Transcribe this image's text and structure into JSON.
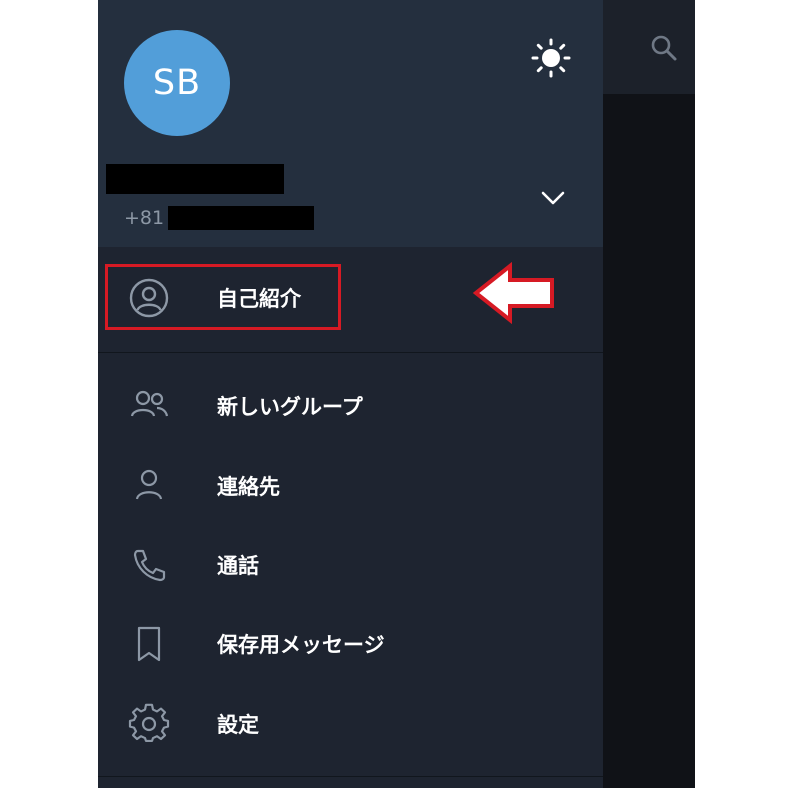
{
  "header": {
    "avatar_initials": "SB",
    "phone_prefix": "+81",
    "avatar_color": "#529ed9",
    "background": "#242f3e"
  },
  "menu": {
    "items": [
      {
        "label": "自己紹介",
        "icon": "profile-circle-icon"
      },
      {
        "label": "新しいグループ",
        "icon": "group-icon"
      },
      {
        "label": "連絡先",
        "icon": "contact-icon"
      },
      {
        "label": "通話",
        "icon": "phone-icon"
      },
      {
        "label": "保存用メッセージ",
        "icon": "bookmark-icon"
      },
      {
        "label": "設定",
        "icon": "gear-icon"
      }
    ]
  },
  "annotation": {
    "highlight_color": "#d61a24",
    "target": "自己紹介"
  },
  "colors": {
    "drawer_bg": "#1e2430",
    "icon": "#8d98a6",
    "text": "#ffffff"
  }
}
